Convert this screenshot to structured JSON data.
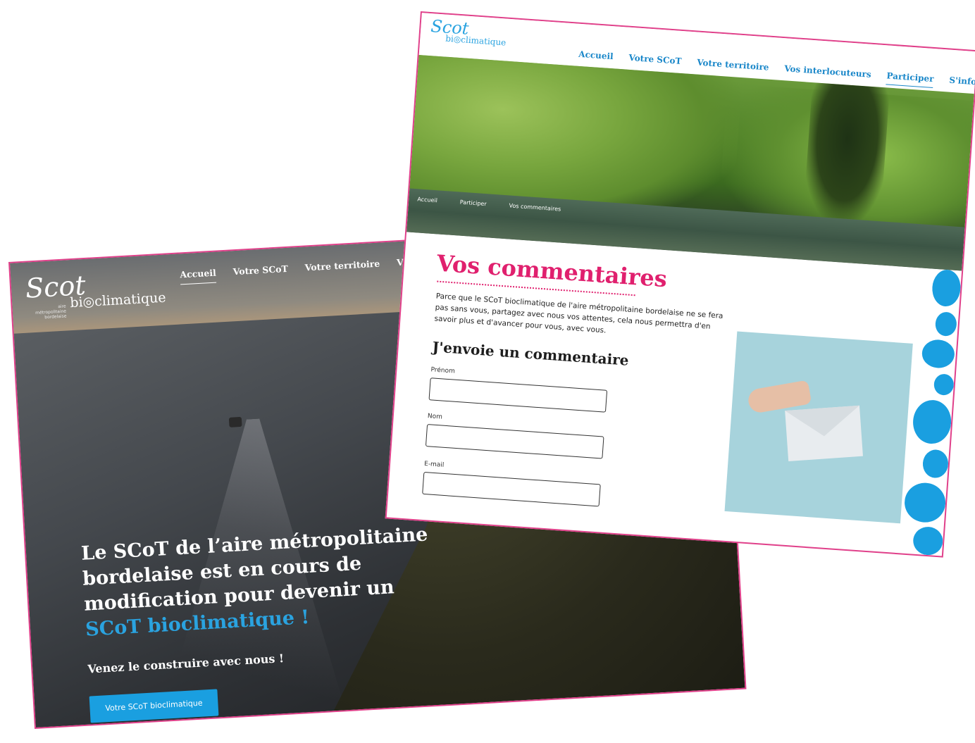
{
  "homepage": {
    "logo_scot": "Scot",
    "logo_bioclimatique": "bi◎climatique",
    "logo_tagline": "aire métropolitaine bordelaise",
    "nav": [
      "Accueil",
      "Votre SCoT",
      "Votre territoire",
      "Vos i"
    ],
    "hero_title": "Le SCoT de l’aire métropolitaine bordelaise est en cours de modification pour devenir un",
    "hero_accent": "SCoT bioclimatique !",
    "subtitle": "Venez le construire avec nous !",
    "cta_label": "Votre SCoT bioclimatique"
  },
  "comments_page": {
    "logo_scot": "Scot",
    "logo_bioclimatique": "bi◎climatique",
    "nav": [
      "Accueil",
      "Votre SCoT",
      "Votre territoire",
      "Vos interlocuteurs",
      "Participer",
      "S'informer"
    ],
    "breadcrumb": [
      "Accueil",
      "Participer",
      "Vos commentaires"
    ],
    "page_title": "Vos commentaires",
    "intro": "Parce que le SCoT bioclimatique de l'aire métropolitaine bordelaise ne se fera pas sans vous, partagez avec nous vos attentes, cela nous permettra d'en savoir plus et d'avancer pour vous, avec vous.",
    "form_title": "J'envoie un commentaire",
    "fields": {
      "first_name_label": "Prénom",
      "last_name_label": "Nom",
      "email_label": "E-mail"
    }
  },
  "colors": {
    "frame_border": "#e0408a",
    "accent_blue": "#1a9fe0",
    "title_pink": "#e0206e"
  }
}
